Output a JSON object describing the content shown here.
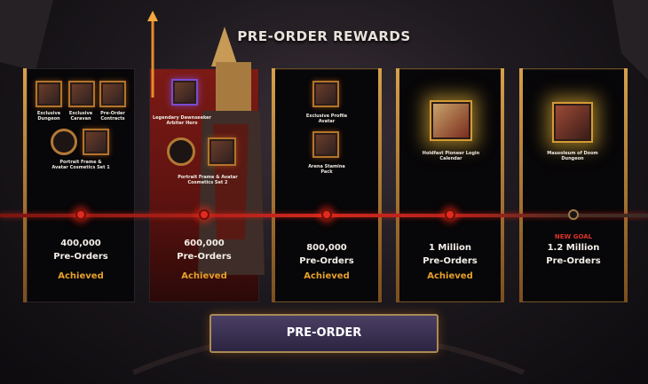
{
  "title": "PRE-ORDER REWARDS",
  "tiers": [
    {
      "count": "400,000",
      "unit": "Pre-Orders",
      "status": "Achieved",
      "rewards": [
        "Exclusive Dungeon",
        "Exclusive Caravan",
        "Pre-Order Contracts",
        "Portrait Frame & Avatar Cosmetics Set 1"
      ]
    },
    {
      "count": "600,000",
      "unit": "Pre-Orders",
      "status": "Achieved",
      "rewards": [
        "Legendary Dawnseeker Arbiter Hero",
        "Portrait Frame & Avatar Cosmetics Set 2"
      ]
    },
    {
      "count": "800,000",
      "unit": "Pre-Orders",
      "status": "Achieved",
      "rewards": [
        "Exclusive Profile Avatar",
        "Arena Stamina Pack"
      ]
    },
    {
      "count": "1 Million",
      "unit": "Pre-Orders",
      "status": "Achieved",
      "rewards": [
        "Holdfast Pioneer Login Calendar"
      ]
    },
    {
      "count": "1.2 Million",
      "unit": "Pre-Orders",
      "status": "NEW GOAL",
      "rewards": [
        "Mausoleum of Doom Dungeon"
      ]
    }
  ],
  "button": {
    "label": "PRE-ORDER"
  },
  "colors": {
    "achieved": "#e6a12a",
    "new_goal": "#e0332b",
    "track": "#d0281e"
  }
}
